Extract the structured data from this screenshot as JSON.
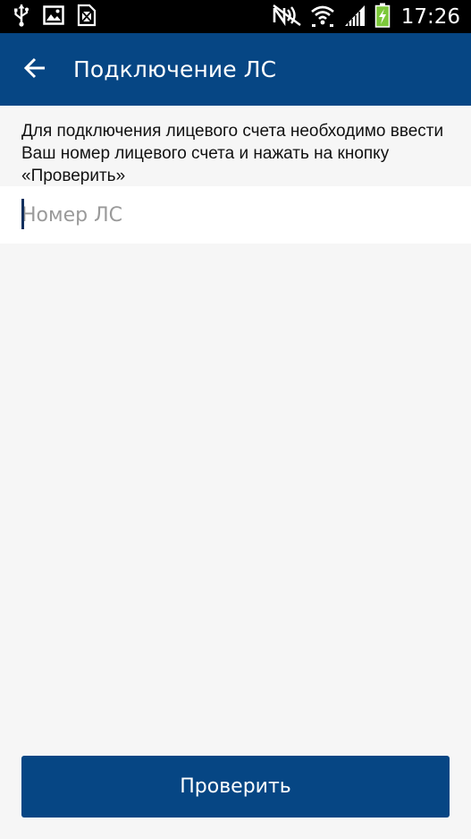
{
  "status_bar": {
    "time": "17:26",
    "left_icons": [
      "usb-icon",
      "image-icon",
      "sim-icon"
    ],
    "right_icons": [
      "nfc-icon",
      "wifi-icon",
      "signal-icon",
      "battery-icon"
    ]
  },
  "app_bar": {
    "title": "Подключение ЛС",
    "back_icon": "arrow-left-icon",
    "color": "#064684"
  },
  "form": {
    "instructions": "Для подключения лицевого счета необходимо ввести Ваш номер лицевого счета и нажать на кнопку «Проверить»",
    "account_input": {
      "value": "",
      "placeholder": "Номер ЛС"
    },
    "check_button_label": "Проверить"
  }
}
